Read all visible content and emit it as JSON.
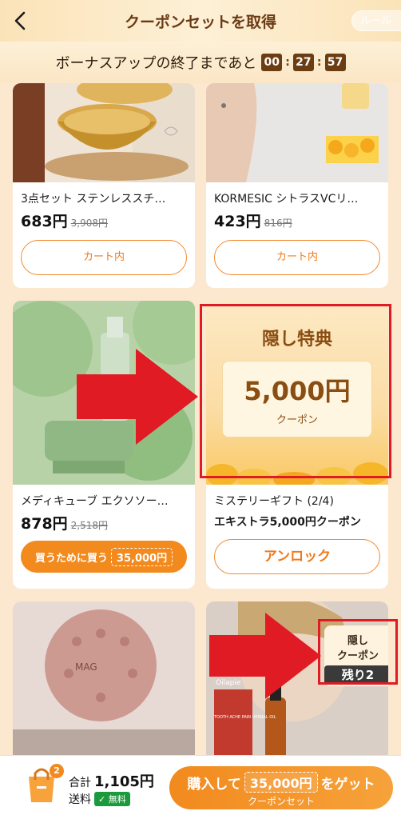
{
  "header": {
    "title": "クーポンセットを取得",
    "rule_label": "ルール"
  },
  "bonus": {
    "text": "ボーナスアップの終了まであと",
    "hours": "00",
    "minutes": "27",
    "seconds": "57"
  },
  "products": [
    {
      "title": "3点セット ステンレススチ…",
      "price": "683円",
      "original": "3,908円",
      "button": "カート内"
    },
    {
      "title": "KORMESIC シトラスVCリ…",
      "price": "423円",
      "original": "816円",
      "button": "カート内"
    },
    {
      "title": "メディキューブ エクソソー…",
      "price": "878円",
      "original": "2,518円",
      "button_prefix": "買うために買う",
      "button_amount": "35,000円"
    }
  ],
  "mystery": {
    "heading": "隠し特典",
    "amount": "5,000円",
    "coupon_label": "クーポン",
    "title": "ミステリーギフト (2/4)",
    "subtitle": "エキストラ5,000円クーポン",
    "button": "アンロック"
  },
  "bottom_cards": {
    "massage_ball_text": "MAG",
    "hidden_coupon_line1": "隠し",
    "hidden_coupon_line2": "クーポン",
    "remaining": "残り2",
    "oil_brand": "Oilapie",
    "oil_label": "TOOTH ACHE PAIN HERBAL OIL"
  },
  "footer": {
    "cart_count": "2",
    "total_label": "合計",
    "total_value": "1,105円",
    "shipping_label": "送料",
    "free_label": "無料",
    "buy_prefix": "購入して",
    "buy_amount": "35,000円",
    "buy_suffix": "をゲット",
    "buy_sub": "クーポンセット"
  },
  "colors": {
    "accent": "#f28a1e",
    "brown": "#6b3d12",
    "annotation_red": "#e01b24"
  }
}
